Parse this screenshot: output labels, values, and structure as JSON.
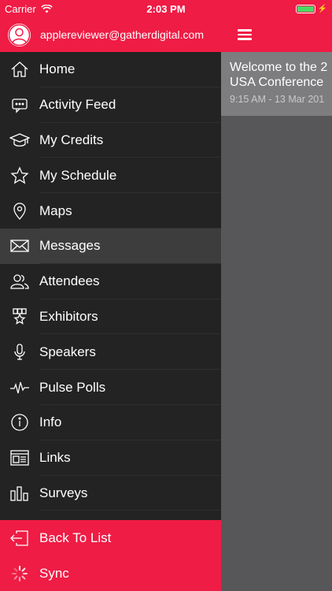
{
  "status": {
    "carrier": "Carrier",
    "time": "2:03 PM"
  },
  "user": {
    "email": "applereviewer@gatherdigital.com"
  },
  "menu": [
    {
      "label": "Home",
      "icon": "home-icon"
    },
    {
      "label": "Activity Feed",
      "icon": "chat-bubble-icon"
    },
    {
      "label": "My Credits",
      "icon": "graduation-cap-icon"
    },
    {
      "label": "My Schedule",
      "icon": "star-icon"
    },
    {
      "label": "Maps",
      "icon": "map-pin-icon"
    },
    {
      "label": "Messages",
      "icon": "envelope-icon",
      "active": true
    },
    {
      "label": "Attendees",
      "icon": "people-icon"
    },
    {
      "label": "Exhibitors",
      "icon": "exhibitor-star-icon"
    },
    {
      "label": "Speakers",
      "icon": "microphone-icon"
    },
    {
      "label": "Pulse Polls",
      "icon": "pulse-icon"
    },
    {
      "label": "Info",
      "icon": "info-icon"
    },
    {
      "label": "Links",
      "icon": "browser-window-icon"
    },
    {
      "label": "Surveys",
      "icon": "bar-chart-icon"
    }
  ],
  "footer": {
    "back_label": "Back To List",
    "sync_label": "Sync"
  },
  "feed": {
    "title_line1": "Welcome to the 2",
    "title_line2": "USA Conference",
    "time": "9:15 AM - 13 Mar 201"
  },
  "colors": {
    "accent": "#ef1c45",
    "drawer_bg": "#232323",
    "active_row": "#3d3d3d",
    "content_bg": "#575759"
  }
}
